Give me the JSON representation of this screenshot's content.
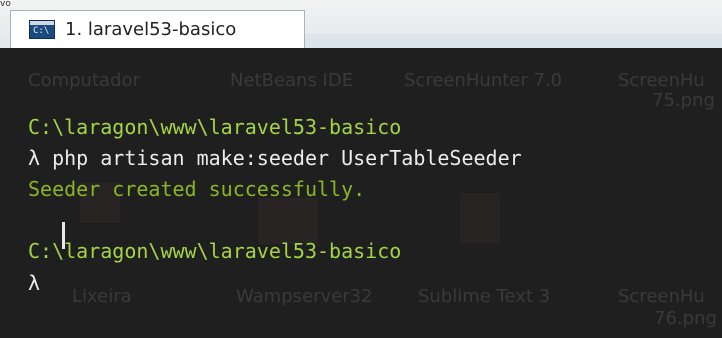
{
  "window": {
    "corner_fragment": "vo",
    "tab": {
      "title": "1. laravel53-basico",
      "icon": "console-icon"
    }
  },
  "background_desktop": {
    "labels": [
      "Computador",
      "NetBeans IDE",
      "ScreenHunter 7.0",
      "ScreenHu",
      "75.png",
      "Lixeira",
      "Wampserver32",
      "Sublime Text 3",
      "ScreenHu",
      "76.png"
    ]
  },
  "terminal": {
    "lines": [
      {
        "kind": "path",
        "text": "C:\\laragon\\www\\laravel53-basico"
      },
      {
        "kind": "command",
        "text": "λ php artisan make:seeder UserTableSeeder"
      },
      {
        "kind": "output",
        "text": "Seeder created successfully."
      },
      {
        "kind": "path",
        "text": "C:\\laragon\\www\\laravel53-basico"
      },
      {
        "kind": "prompt",
        "text": "λ "
      }
    ],
    "colors": {
      "path": "#a3d444",
      "command": "#ececec",
      "output": "#89b724",
      "background": "#1f1f1f"
    }
  }
}
